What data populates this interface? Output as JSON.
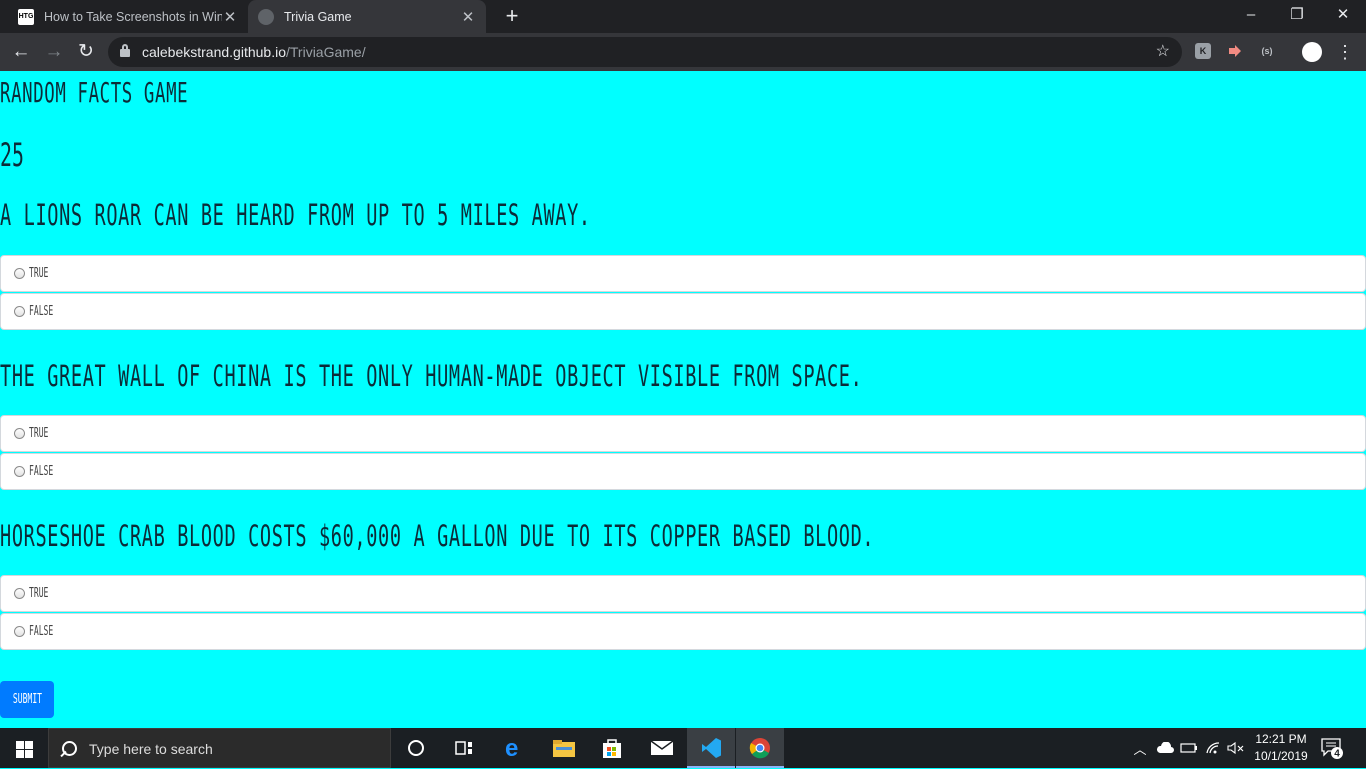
{
  "browser": {
    "tabs": [
      {
        "title": "How to Take Screenshots in Wind",
        "favicon": "htg-favicon-icon",
        "favicon_text": "HTG",
        "active": false
      },
      {
        "title": "Trivia Game",
        "favicon": "globe-icon",
        "active": true
      }
    ],
    "address": {
      "domain": "calebekstrand.github.io",
      "path": "/TriviaGame/"
    },
    "extensions": [
      "extension-k-icon",
      "extension-arrow-icon",
      "extension-s-icon"
    ],
    "extension_k_text": "K",
    "extension_s_text": "(s)"
  },
  "page": {
    "title": "Random Facts Game",
    "timer": "25",
    "questions": [
      {
        "text": "A lions roar can be heard from up to 5 miles away.",
        "options": [
          "True",
          "False"
        ]
      },
      {
        "text": "The Great Wall of China is the only human-made object visible from space.",
        "options": [
          "True",
          "False"
        ]
      },
      {
        "text": "Horseshoe crab blood costs $60,000 a gallon due to its copper based blood.",
        "options": [
          "True",
          "False"
        ]
      }
    ],
    "submit_label": "Submit",
    "colors": {
      "background": "#00ffff",
      "submit": "#007bff",
      "text": "#0c2b38"
    }
  },
  "taskbar": {
    "search_placeholder": "Type here to search",
    "apps": [
      "cortana-icon",
      "task-view-icon",
      "edge-icon",
      "file-explorer-icon",
      "store-icon",
      "mail-icon",
      "vscode-icon",
      "chrome-icon"
    ],
    "time": "12:21 PM",
    "date": "10/1/2019",
    "notifications": "4"
  }
}
